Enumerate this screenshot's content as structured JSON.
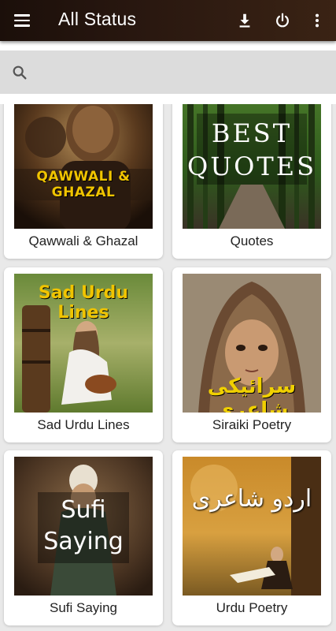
{
  "appbar": {
    "title": "All Status",
    "menu_icon": "menu-icon",
    "actions": [
      "download-icon",
      "power-icon",
      "more-vert-icon"
    ]
  },
  "search": {
    "value": "",
    "placeholder": ""
  },
  "cards": [
    {
      "label": "Qawwali & Ghazal",
      "overlay": "QAWWALI & GHAZAL"
    },
    {
      "label": "Quotes",
      "overlay_line1": "BEST",
      "overlay_line2": "QUOTES"
    },
    {
      "label": "Sad Urdu Lines",
      "overlay": "Sad Urdu Lines"
    },
    {
      "label": "Siraiki Poetry",
      "overlay": "سرائیکی شاعری"
    },
    {
      "label": "Sufi Saying",
      "overlay_line1": "Sufi",
      "overlay_line2": "Saying"
    },
    {
      "label": "Urdu Poetry",
      "overlay": "اردو شاعری"
    }
  ],
  "colors": {
    "appbar_dark": "#1b0f0a",
    "appbar_light": "#3a2314",
    "background": "#e9e9e9",
    "search_box": "#dcdcdc",
    "overlay_gold": "#f0c400"
  }
}
